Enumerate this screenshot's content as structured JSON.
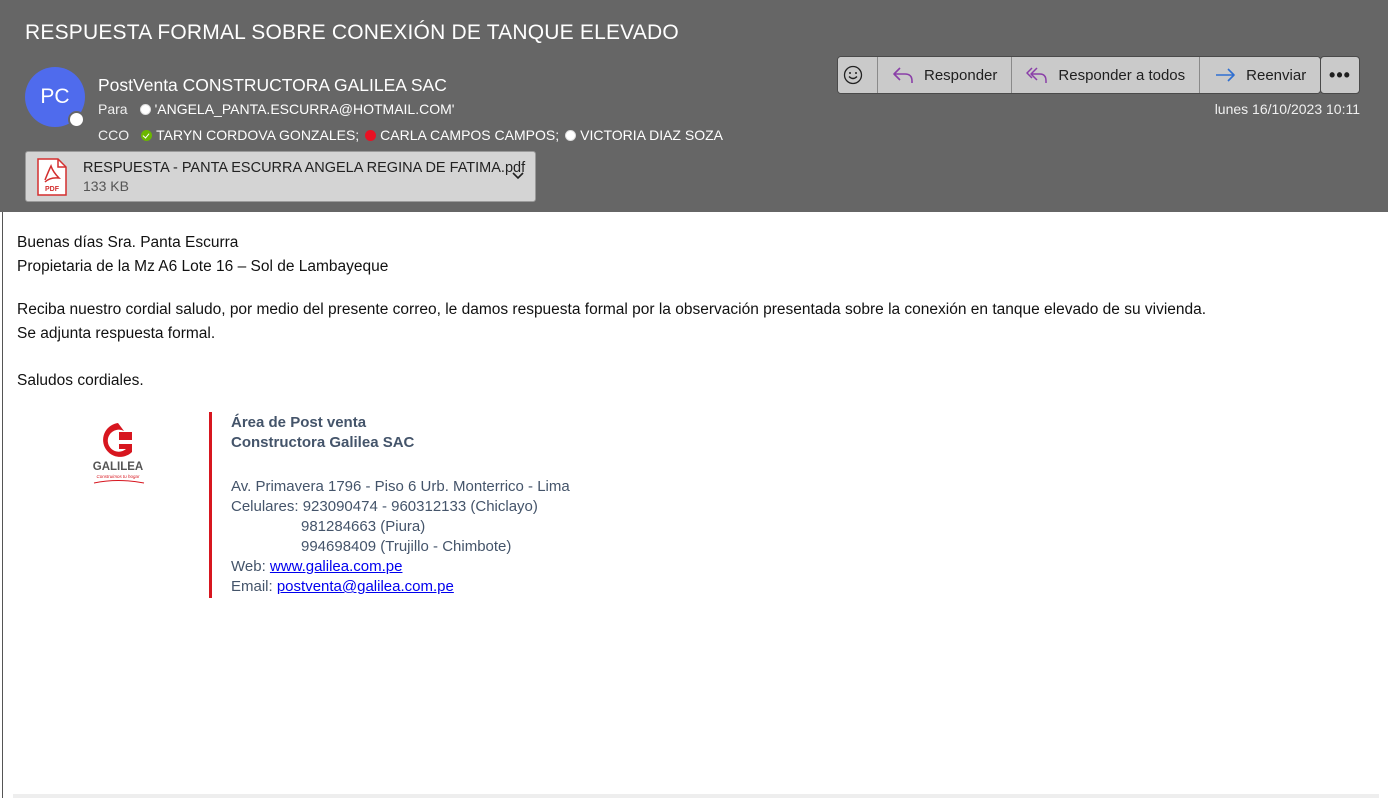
{
  "email": {
    "subject": "RESPUESTA FORMAL SOBRE CONEXIÓN DE TANQUE ELEVADO",
    "avatar_initials": "PC",
    "sender": "PostVenta CONSTRUCTORA GALILEA SAC",
    "to_label": "Para",
    "to": [
      "'ANGELA_PANTA.ESCURRA@HOTMAIL.COM'"
    ],
    "cco_label": "CCO",
    "cco": [
      {
        "name": "TARYN CORDOVA GONZALES;",
        "presence": "online"
      },
      {
        "name": "CARLA CAMPOS CAMPOS;",
        "presence": "busy"
      },
      {
        "name": "VICTORIA DIAZ SOZA",
        "presence": "offline"
      }
    ],
    "date": "lunes 16/10/2023 10:11"
  },
  "toolbar": {
    "emoji_icon": "smiley-icon",
    "reply_label": "Responder",
    "reply_all_label": "Responder a todos",
    "forward_label": "Reenviar",
    "more_label": "•••"
  },
  "attachment": {
    "name": "RESPUESTA - PANTA ESCURRA ANGELA REGINA DE FATIMA.pdf",
    "size": "133 KB",
    "icon_text": "PDF"
  },
  "body": {
    "greeting": "Buenas días Sra. Panta Escurra",
    "line2": "Propietaria de la Mz A6 Lote 16 – Sol de Lambayeque",
    "paragraph1": "Reciba nuestro cordial saludo, por medio del presente correo, le damos respuesta formal por la observación presentada sobre la conexión en tanque elevado de su vivienda.",
    "paragraph2": "Se adjunta respuesta formal.",
    "closing": "Saludos cordiales."
  },
  "signature": {
    "logo_name": "GALILEA",
    "logo_tagline": "Construimos tu hogar",
    "dept": "Área de Post venta",
    "company": "Constructora Galilea SAC",
    "address": "Av. Primavera 1796 - Piso 6 Urb. Monterrico - Lima",
    "phones_label": "Celulares: ",
    "phones_1": "923090474 - 960312133 (Chiclayo)",
    "phones_2": "981284663 (Piura)",
    "phones_3": "994698409 (Trujillo - Chimbote)",
    "web_label": "Web: ",
    "web": "www.galilea.com.pe",
    "email_label": "Email: ",
    "email": "postventa@galilea.com.pe"
  },
  "colors": {
    "header_bg": "#666666",
    "avatar_bg": "#4f6bed",
    "accent_red": "#d7161f",
    "signature_text": "#44546a",
    "link": "#0000ee"
  }
}
